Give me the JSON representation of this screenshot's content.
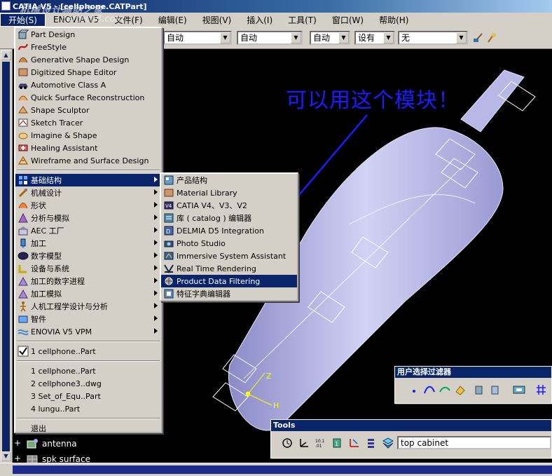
{
  "window": {
    "title": "CATIA V5 - [cellphone.CATPart]"
  },
  "watermark": {
    "text1": "机械设计辅助之家",
    "text2": "cartech8.com"
  },
  "menubar": {
    "items": [
      "开始(S)",
      "ENOVIA V5",
      "文件(F)",
      "编辑(E)",
      "视图(V)",
      "插入(I)",
      "工具(T)",
      "窗口(W)",
      "帮助(H)"
    ]
  },
  "toolbar": {
    "combo1": "自动",
    "combo2": "自动",
    "combo3": "自动",
    "combo4": "设有",
    "combo5": "无"
  },
  "start_menu": {
    "items": [
      {
        "label": "Part Design",
        "icon": "part-design-icon"
      },
      {
        "label": "FreeStyle",
        "icon": "freestyle-icon"
      },
      {
        "label": "Generative Shape Design",
        "icon": "generative-shape-icon"
      },
      {
        "label": "Digitized Shape Editor",
        "icon": "digitized-shape-icon"
      },
      {
        "label": "Automotive Class A",
        "icon": "automotive-icon"
      },
      {
        "label": "Quick Surface Reconstruction",
        "icon": "quick-surface-icon"
      },
      {
        "label": "Shape Sculptor",
        "icon": "shape-sculptor-icon"
      },
      {
        "label": "Sketch Tracer",
        "icon": "sketch-tracer-icon"
      },
      {
        "label": "Imagine & Shape",
        "icon": "imagine-shape-icon"
      },
      {
        "label": "Healing Assistant",
        "icon": "healing-icon"
      },
      {
        "label": "Wireframe and Surface Design",
        "icon": "wireframe-icon"
      }
    ],
    "categories": [
      {
        "label": "基础结构",
        "icon": "infrastructure-icon",
        "selected": true
      },
      {
        "label": "机械设计",
        "icon": "mechanical-icon"
      },
      {
        "label": "形状",
        "icon": "shape-icon"
      },
      {
        "label": "分析与模拟",
        "icon": "analysis-icon"
      },
      {
        "label": "AEC 工厂",
        "icon": "aec-icon"
      },
      {
        "label": "加工",
        "icon": "machining-icon"
      },
      {
        "label": "数字模型",
        "icon": "digital-mockup-icon"
      },
      {
        "label": "设备与系统",
        "icon": "equipment-icon"
      },
      {
        "label": "加工的数字进程",
        "icon": "digital-process-icon"
      },
      {
        "label": "加工模拟",
        "icon": "machining-sim-icon"
      },
      {
        "label": "人机工程学设计与分析",
        "icon": "ergonomics-icon"
      },
      {
        "label": "智件",
        "icon": "knowledgeware-icon"
      },
      {
        "label": "ENOVIA V5 VPM",
        "icon": "enovia-icon"
      }
    ],
    "recent_checked": "1 cellphone..Part",
    "recent": [
      "1 cellphone..Part",
      "2 cellphone3..dwg",
      "3 Set_of_Equ..Part",
      "4 lungu..Part"
    ],
    "exit": "退出"
  },
  "submenu": {
    "items": [
      {
        "label": "产品结构",
        "icon": "product-structure-icon"
      },
      {
        "label": "Material Library",
        "icon": "material-library-icon"
      },
      {
        "label": "CATIA V4、V3、V2",
        "icon": "catia-v4-icon"
      },
      {
        "label": "库 ( catalog ) 编辑器",
        "icon": "catalog-editor-icon"
      },
      {
        "label": "DELMIA D5 Integration",
        "icon": "delmia-icon"
      },
      {
        "label": "Photo Studio",
        "icon": "photo-studio-icon"
      },
      {
        "label": "Immersive System Assistant",
        "icon": "immersive-icon"
      },
      {
        "label": "Real Time Rendering",
        "icon": "rendering-icon"
      },
      {
        "label": "Product Data Filtering",
        "icon": "data-filtering-icon",
        "selected": true
      },
      {
        "label": "特征字典编辑器",
        "icon": "feature-dictionary-icon"
      }
    ]
  },
  "annotation": {
    "text": "可以用这个模块！"
  },
  "tree": {
    "items": [
      {
        "label": "antenna",
        "icon": "antenna-icon"
      },
      {
        "label": "spk surface",
        "icon": "surface-icon"
      }
    ]
  },
  "filter_panel": {
    "title": "用户选择过滤器"
  },
  "tools_panel": {
    "title": "Tools",
    "combo": "top cabinet"
  },
  "colors": {
    "accent": "#0a246a",
    "part": "#c8c8f0",
    "annotation": "#1c1cff"
  }
}
